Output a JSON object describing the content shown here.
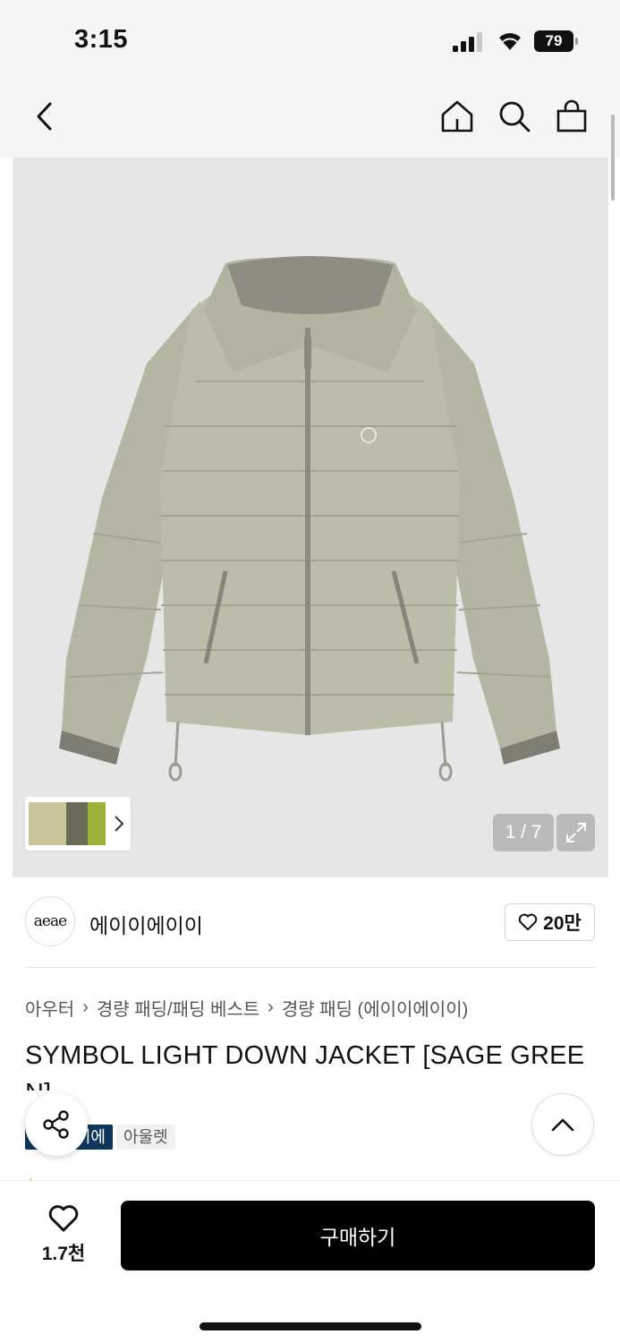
{
  "status_bar": {
    "time": "3:15",
    "battery": "79"
  },
  "nav": {
    "back_icon": "chevron-left-icon",
    "home_icon": "home-icon",
    "search_icon": "search-icon",
    "bag_icon": "shopping-bag-icon"
  },
  "gallery": {
    "page_indicator": "1 / 7",
    "expand_icon": "expand-icon"
  },
  "brand": {
    "logo_text": "aeae",
    "name": "에이이에이이",
    "likes": "20만"
  },
  "breadcrumb": [
    "아우터",
    "경량 패딩/패딩 베스트",
    "경량 패딩 (에이이에이이)"
  ],
  "product": {
    "title": "SYMBOL LIGHT DOWN JACKET [SAGE GREEN]",
    "tags": [
      "에이이에이이",
      "아울렛"
    ]
  },
  "bottom": {
    "wish_count": "1.7천",
    "buy_label": "구매하기"
  },
  "colors": {
    "sage": "#b8b9a4",
    "sage_dark": "#9fa08b",
    "lining": "#8d8d83",
    "navy_tag": "#0f3659"
  }
}
